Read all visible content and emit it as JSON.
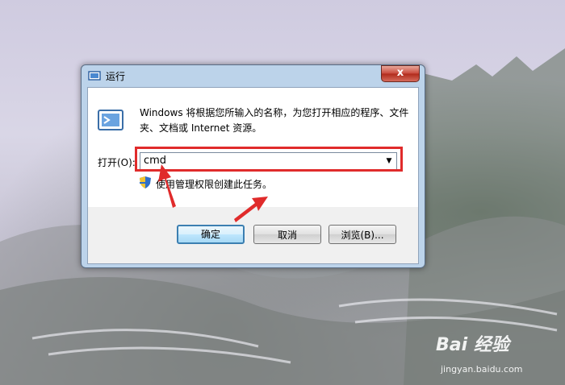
{
  "dialog": {
    "title": "运行",
    "close": "x",
    "description": "Windows 将根据您所输入的名称，为您打开相应的程序、文件夹、文档或 Internet 资源。",
    "open_label": "打开(O):",
    "command_value": "cmd",
    "admin_note": "使用管理权限创建此任务。",
    "buttons": {
      "ok": "确定",
      "cancel": "取消",
      "browse": "浏览(B)..."
    }
  },
  "watermark": {
    "brand": "Bai 经验",
    "url": "jingyan.baidu.com"
  },
  "colors": {
    "highlight_box": "#e02b2b",
    "close_button": "#c8473a",
    "default_button_border": "#3c7fb1"
  },
  "icons": [
    "run-icon",
    "shield-icon",
    "close-icon",
    "dropdown-arrow-icon"
  ]
}
